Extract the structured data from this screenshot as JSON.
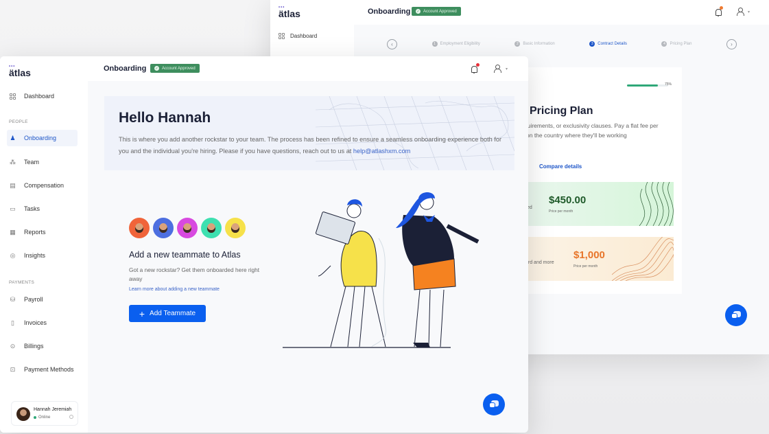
{
  "back_window": {
    "logo": "ätlas",
    "title": "Onboarding",
    "badge": "Account Approved",
    "sidebar": {
      "dashboard": "Dashboard"
    },
    "steps": [
      {
        "n": "1",
        "label": "Employment Eligibility",
        "state": "done"
      },
      {
        "n": "2",
        "label": "Basic Information",
        "state": "done"
      },
      {
        "n": "3",
        "label": "Contract Details",
        "state": "active"
      },
      {
        "n": "4",
        "label": "Pricing Plan",
        "state": "pending"
      }
    ],
    "progress": {
      "value": 0.75,
      "label": "75%"
    },
    "pricing_title": "Pricing Plan",
    "pricing_desc_line1": "quirements, or exclusivity clauses. Pay a flat fee per",
    "pricing_desc_line2": "on the country where they'll be working",
    "compare_label": "Compare details",
    "plans": [
      {
        "left_text": "ted",
        "price": "$450.00",
        "sub": "Price per month",
        "color": "#1f5a2a",
        "line_color": "#2a5a33"
      },
      {
        "left_text": "ard and more",
        "price": "$1,000",
        "sub": "Price per month",
        "color": "#e8752a",
        "line_color": "#d99060"
      }
    ],
    "notification_dot_color": "#ef7a30"
  },
  "front_window": {
    "logo": "ätlas",
    "title": "Onboarding",
    "badge": "Account Approved",
    "sidebar": {
      "dashboard": "Dashboard",
      "section_people": "PEOPLE",
      "people_items": [
        "Onboarding",
        "Team",
        "Compensation",
        "Tasks",
        "Reports",
        "Insights"
      ],
      "section_payments": "PAYMENTS",
      "payment_items": [
        "Payroll",
        "Invoices",
        "Billings",
        "Payment Methods"
      ],
      "active": "Onboarding"
    },
    "profile": {
      "name": "Hannah Jeremiah",
      "status": "Online"
    },
    "hero": {
      "greeting": "Hello Hannah",
      "text": "This is where you add another rockstar to your team. The process has been refined to ensure a seamless onboarding experience both for you and the individual you're hiring. Please if you have questions, reach out to us at ",
      "email": "help@atlashxm.com"
    },
    "add_teammate": {
      "title": "Add a new teammate to Atlas",
      "desc": "Got a new rockstar? Get them onboarded here right away",
      "link": "Learn more about adding a new teammate",
      "button": "Add Teammate",
      "avatar_colors": [
        "#f0643a",
        "#4d6fe0",
        "#d84ae0",
        "#3ee0b0",
        "#f6e14a"
      ]
    },
    "notification_dot_color": "#e8303a",
    "brand_color": "#0a5fef"
  }
}
